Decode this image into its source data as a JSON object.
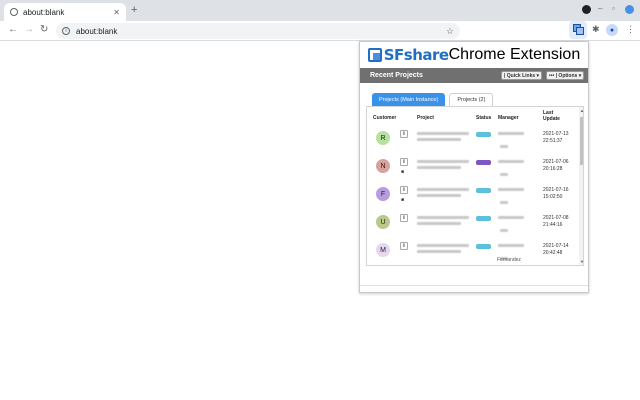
{
  "browser": {
    "tab_title": "about:blank",
    "tab_close": "✕",
    "new_tab": "+",
    "url": "about:blank",
    "info_glyph": "i",
    "back": "←",
    "forward": "→",
    "reload": "↻",
    "star": "☆",
    "puzzle": "✱",
    "menu": "⋮",
    "avatar_glyph": "●",
    "win_min": "–",
    "win_max": "▫",
    "win_close": "✕"
  },
  "popup": {
    "brand": "SFshare",
    "brand_sub": "Chrome Extension",
    "header_title": "Recent Projects",
    "quick_links": "| Quick Links ▾",
    "options": "••• | Options ▾",
    "tabs": [
      {
        "label": "Projects (Main Instance)",
        "active": true
      },
      {
        "label": "Projects (2)",
        "active": false
      }
    ],
    "columns": {
      "customer": "Customer",
      "project": "Project",
      "status": "Status",
      "manager": "Manager",
      "last_update_1": "Last",
      "last_update_2": "Update"
    },
    "rows": [
      {
        "initial": "R",
        "avatar_color": "#b7e1a1",
        "status_color": "#5bc0de",
        "date": "2021-07-13",
        "time": "22:51:37",
        "has_cam": false
      },
      {
        "initial": "N",
        "avatar_color": "#d9a19b",
        "status_color": "#7e57c2",
        "date": "2021-07-06",
        "time": "20:16:28",
        "has_cam": true
      },
      {
        "initial": "F",
        "avatar_color": "#b79ce0",
        "status_color": "#5bc0de",
        "date": "2021-07-16",
        "time": "15:02:50",
        "has_cam": true
      },
      {
        "initial": "U",
        "avatar_color": "#b9c98a",
        "status_color": "#5bc0de",
        "date": "2021-07-08",
        "time": "21:44:16",
        "has_cam": false
      },
      {
        "initial": "M",
        "avatar_color": "#e6d7f0",
        "status_color": "#5bc0de",
        "date": "2021-07-14",
        "time": "20:42:48",
        "has_cam": false,
        "manager_extra": "Fernandez"
      }
    ],
    "scroll_up": "▲",
    "scroll_down": "▼",
    "mail_glyph": "✉",
    "info_glyph": "i",
    "cam_glyph": "■"
  }
}
